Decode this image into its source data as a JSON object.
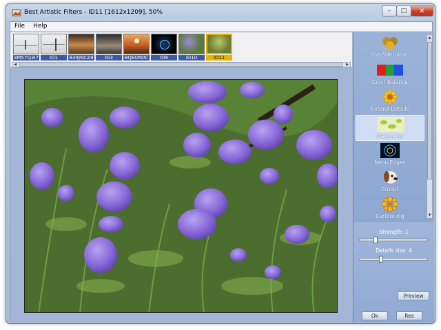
{
  "window": {
    "title": "Best Artistic Filters - ID11 [1612x1209], 50%"
  },
  "controls": {
    "minimize": "–",
    "maximize": "□",
    "close": "✕"
  },
  "menu": [
    {
      "label": "File"
    },
    {
      "label": "Help"
    }
  ],
  "thumbnails": [
    {
      "label": "3M57Q3I7"
    },
    {
      "label": "ID1"
    },
    {
      "label": "839JNCZ8"
    },
    {
      "label": "ID3"
    },
    {
      "label": "BQEON0C"
    },
    {
      "label": "ID8"
    },
    {
      "label": "ID10"
    },
    {
      "label": "ID11",
      "selected": true
    }
  ],
  "filters": [
    {
      "label": "Hue/Saturation",
      "icon": "hue-saturation-icon"
    },
    {
      "label": "Color Balance",
      "icon": "color-balance-icon"
    },
    {
      "label": "Extend Details",
      "icon": "extend-details-icon"
    },
    {
      "label": "Watercolor",
      "icon": "watercolor-icon",
      "selected": true
    },
    {
      "label": "Neon Edges",
      "icon": "neon-edges-icon"
    },
    {
      "label": "Cutout",
      "icon": "cutout-icon"
    },
    {
      "label": "Cartooning",
      "icon": "cartooning-icon"
    }
  ],
  "settings": {
    "strength_label": "Strength: 1",
    "strength_value": 1,
    "details_label": "Details size: 4",
    "details_value": 4
  },
  "buttons": {
    "preview": "Preview",
    "ok": "Ok",
    "reset": "Res"
  },
  "colors": {
    "accent": "#3c59a8",
    "selected_thumb": "#e8b400",
    "panel": "#8ea6cf"
  }
}
